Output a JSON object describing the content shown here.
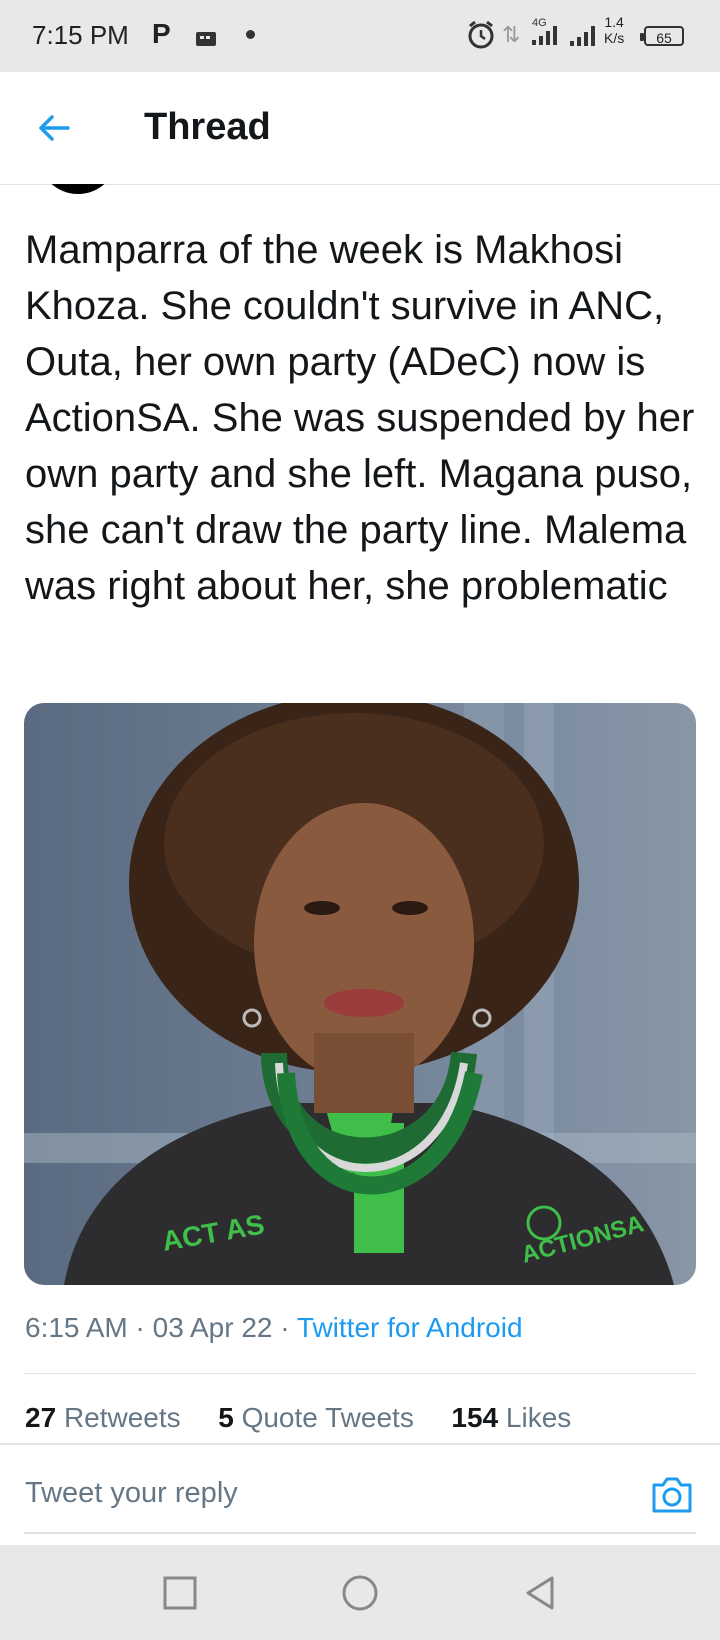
{
  "status_bar": {
    "time": "7:15 PM",
    "p_icon": "P",
    "network": "4G",
    "speed_value": "1.4",
    "speed_unit": "K/s",
    "battery": "65"
  },
  "header": {
    "title": "Thread",
    "back_icon": "arrow-left-icon"
  },
  "tweet": {
    "text": "Mamparra of the week is Makhosi Khoza.  She couldn't survive in ANC, Outa, her own party (ADeC) now is ActionSA. She was suspended by her own party and she left. Magana puso, she can't draw the party line. Malema was right about her, she problematic",
    "time": "6:15 AM",
    "date": "03 Apr 22",
    "source": "Twitter for Android",
    "photo_text": [
      "ACT AS",
      "ACTIONSA"
    ]
  },
  "stats": {
    "retweets_count": "27",
    "retweets_label": "Retweets",
    "quotes_count": "5",
    "quotes_label": "Quote Tweets",
    "likes_count": "154",
    "likes_label": "Likes"
  },
  "reply": {
    "placeholder": "Tweet your reply",
    "camera_icon": "camera-icon"
  },
  "colors": {
    "accent": "#1d9bf0",
    "secondary_text": "#657786",
    "primary_text": "#14171a"
  }
}
